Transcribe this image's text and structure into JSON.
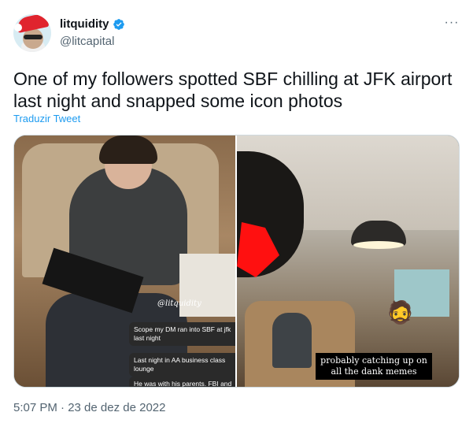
{
  "author": {
    "display_name": "litquidity",
    "handle": "@litcapital",
    "verified_icon": "verified-badge-icon",
    "badge_color": "#1d9bf0"
  },
  "menu": {
    "more_icon": "more-dots-icon",
    "label": "···"
  },
  "tweet": {
    "text": "One of my followers spotted SBF chilling at JFK airport last night and snapped some icon photos",
    "translate_label": "Traduzir Tweet",
    "timestamp": "5:07 PM · 23 de dez de 2022"
  },
  "media": {
    "left_photo": {
      "watermark": "@litquidity",
      "dm_messages": [
        "Scope my DM ran into SBF at jfk last night",
        "Last night in AA business class lounge",
        "He was with his parents. FBI and"
      ]
    },
    "right_photo": {
      "caption": "probably catching up on all the dank memes"
    }
  },
  "colors": {
    "link": "#1d9bf0",
    "secondary_text": "#536471",
    "primary_text": "#0f1419"
  }
}
